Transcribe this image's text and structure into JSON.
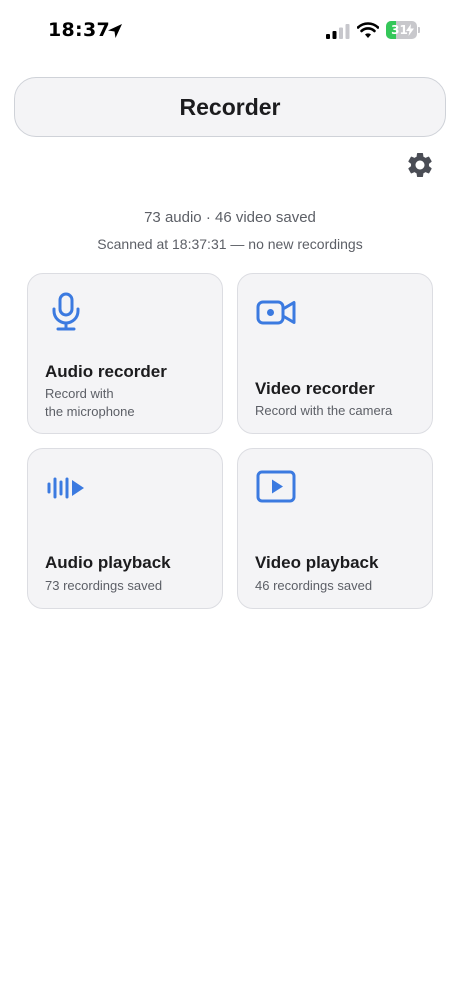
{
  "status_bar": {
    "time": "18:37",
    "battery_level": "31",
    "battery_fraction": 0.31
  },
  "header": {
    "title": "Recorder"
  },
  "summary": {
    "counts": "73 audio · 46 video saved",
    "scan_status": "Scanned at 18:37:31 — no new recordings"
  },
  "cards": {
    "audio_recorder": {
      "title": "Audio recorder",
      "subtitle_line1": "Record with",
      "subtitle_line2": "the microphone",
      "icon": "microphone-icon"
    },
    "video_recorder": {
      "title": "Video recorder",
      "subtitle": "Record with the camera",
      "icon": "video-camera-icon"
    },
    "audio_playback": {
      "title": "Audio playback",
      "subtitle": "73 recordings saved",
      "icon": "waveform-play-icon"
    },
    "video_playback": {
      "title": "Video playback",
      "subtitle": "46 recordings saved",
      "icon": "play-screen-icon"
    }
  },
  "colors": {
    "accent": "#3b7ae0",
    "card_bg": "#f4f4f6",
    "battery_green": "#34c759"
  }
}
